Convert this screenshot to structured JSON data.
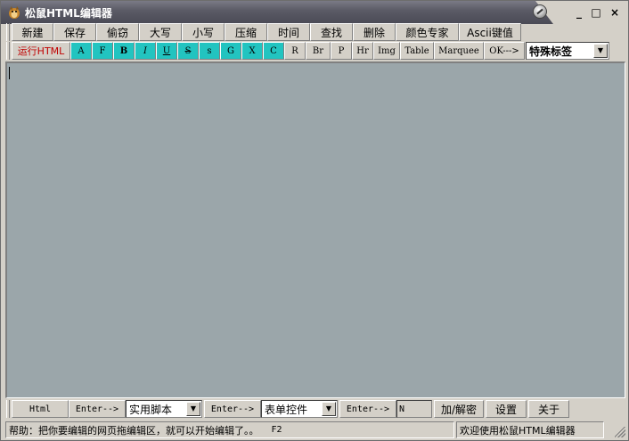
{
  "window": {
    "title": "松鼠HTML编辑器",
    "controls": [
      "○",
      "_",
      "□",
      "×"
    ]
  },
  "menu": [
    "新建",
    "保存",
    "偷窃",
    "大写",
    "小写",
    "压缩",
    "时间",
    "查找",
    "删除",
    "颜色专家",
    "Ascii键值"
  ],
  "toolbar": {
    "run_label": "运行HTML",
    "format_buttons": [
      "A",
      "F",
      "B",
      "I",
      "U",
      "S",
      "s",
      "G",
      "X",
      "C"
    ],
    "tag_buttons": [
      "R",
      "Br",
      "P",
      "Hr",
      "Img",
      "Table",
      "Marquee",
      "OK--->"
    ],
    "special_tags": {
      "value": "特殊标签"
    }
  },
  "editor": {
    "content": ""
  },
  "bottom": {
    "html_button": "Html",
    "enter1": "Enter-->",
    "scripts_combo": "实用脚本",
    "enter2": "Enter-->",
    "form_combo": "表单控件",
    "enter3": "Enter-->",
    "n_field": "N",
    "encrypt_button": "加/解密",
    "settings_button": "设置",
    "about_button": "关于"
  },
  "status": {
    "help": "帮助：把你要编辑的网页拖编辑区，就可以开始编辑了。。",
    "key": "F2",
    "welcome": "欢迎使用松鼠HTML编辑器"
  },
  "colors": {
    "editor_bg": "#9ba6aa",
    "teal": "#22c4c0",
    "face": "#d4d0c8",
    "run_text": "#c00000"
  }
}
